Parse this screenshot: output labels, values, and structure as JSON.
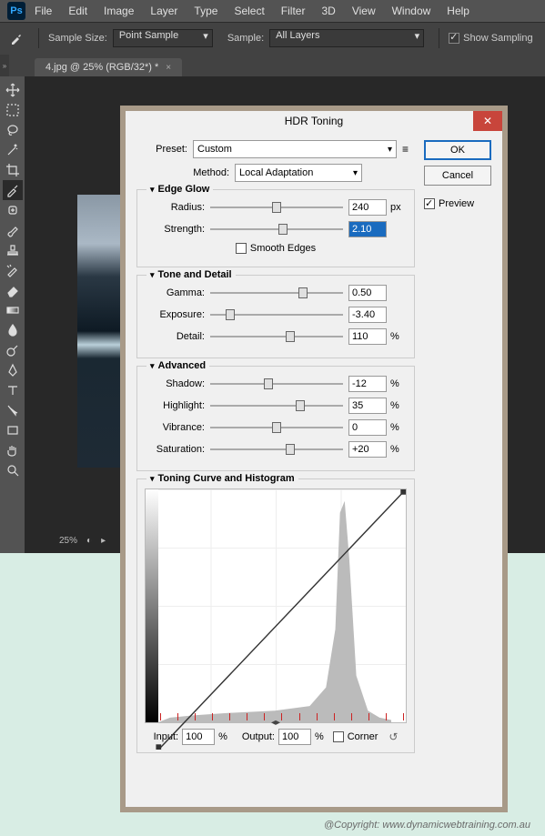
{
  "menubar": [
    "File",
    "Edit",
    "Image",
    "Layer",
    "Type",
    "Select",
    "Filter",
    "3D",
    "View",
    "Window",
    "Help"
  ],
  "optbar": {
    "sample_size_label": "Sample Size:",
    "sample_size_value": "Point Sample",
    "sample_label": "Sample:",
    "sample_value": "All Layers",
    "show_sampling": "Show Sampling"
  },
  "doctab": {
    "title": "4.jpg @ 25% (RGB/32*) *",
    "close": "×"
  },
  "zoom": "25%",
  "dialog": {
    "title": "HDR Toning",
    "ok": "OK",
    "cancel": "Cancel",
    "preview": "Preview",
    "preset_label": "Preset:",
    "preset_value": "Custom",
    "method_label": "Method:",
    "method_value": "Local Adaptation",
    "edge_glow": {
      "title": "Edge Glow",
      "radius_label": "Radius:",
      "radius_value": "240",
      "radius_unit": "px",
      "strength_label": "Strength:",
      "strength_value": "2.10",
      "smooth": "Smooth Edges"
    },
    "tone": {
      "title": "Tone and Detail",
      "gamma_label": "Gamma:",
      "gamma_value": "0.50",
      "exposure_label": "Exposure:",
      "exposure_value": "-3.40",
      "detail_label": "Detail:",
      "detail_value": "110",
      "pct": "%"
    },
    "advanced": {
      "title": "Advanced",
      "shadow_label": "Shadow:",
      "shadow_value": "-12",
      "highlight_label": "Highlight:",
      "highlight_value": "35",
      "vibrance_label": "Vibrance:",
      "vibrance_value": "0",
      "saturation_label": "Saturation:",
      "saturation_value": "+20",
      "pct": "%"
    },
    "curve": {
      "title": "Toning Curve and Histogram",
      "input_label": "Input:",
      "input_value": "100",
      "output_label": "Output:",
      "output_value": "100",
      "pct": "%",
      "corner": "Corner"
    }
  },
  "copyright": "@Copyright: www.dynamicwebtraining.com.au"
}
